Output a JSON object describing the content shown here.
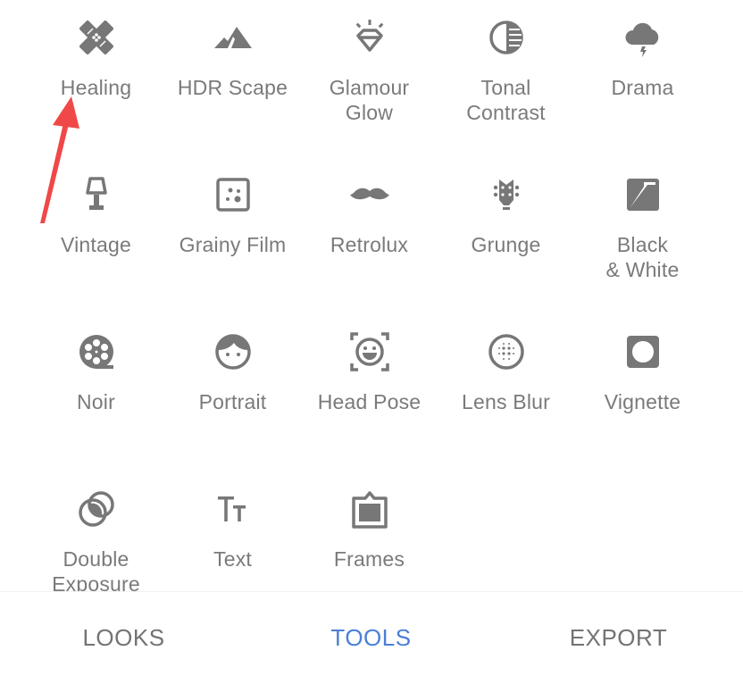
{
  "tools": [
    {
      "label": "Healing",
      "icon": "bandage-icon"
    },
    {
      "label": "HDR Scape",
      "icon": "mountains-icon"
    },
    {
      "label": "Glamour\nGlow",
      "icon": "diamond-icon"
    },
    {
      "label": "Tonal\nContrast",
      "icon": "tonal-circle-icon"
    },
    {
      "label": "Drama",
      "icon": "storm-cloud-icon"
    },
    {
      "label": "Vintage",
      "icon": "lamp-icon"
    },
    {
      "label": "Grainy Film",
      "icon": "grain-dots-icon"
    },
    {
      "label": "Retrolux",
      "icon": "mustache-icon"
    },
    {
      "label": "Grunge",
      "icon": "guitar-head-icon"
    },
    {
      "label": "Black\n& White",
      "icon": "black-white-icon"
    },
    {
      "label": "Noir",
      "icon": "film-reel-icon"
    },
    {
      "label": "Portrait",
      "icon": "face-icon"
    },
    {
      "label": "Head Pose",
      "icon": "face-frame-icon"
    },
    {
      "label": "Lens Blur",
      "icon": "lens-blur-icon"
    },
    {
      "label": "Vignette",
      "icon": "vignette-icon"
    },
    {
      "label": "Double\nExposure",
      "icon": "double-exposure-icon"
    },
    {
      "label": "Text",
      "icon": "text-icon"
    },
    {
      "label": "Frames",
      "icon": "frame-icon"
    }
  ],
  "tabs": [
    {
      "label": "LOOKS",
      "active": false
    },
    {
      "label": "TOOLS",
      "active": true
    },
    {
      "label": "EXPORT",
      "active": false
    }
  ],
  "colors": {
    "icon": "#777777",
    "label": "#7a7a7a",
    "active_tab": "#4a7fd8",
    "inactive_tab": "#737373",
    "annotation_arrow": "#f04848"
  }
}
